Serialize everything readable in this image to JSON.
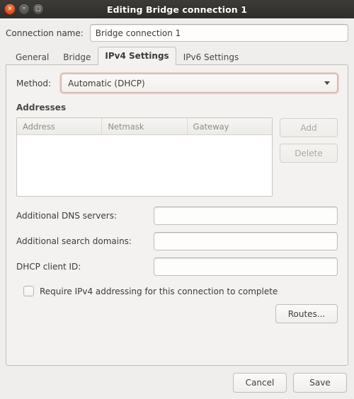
{
  "window": {
    "title": "Editing Bridge connection 1",
    "controls": {
      "close_glyph": "×",
      "minimize_glyph": "–",
      "maximize_glyph": "□"
    },
    "accent_color": "#dd7249",
    "titlebar_color": "#3c3b37"
  },
  "connection": {
    "name_label": "Connection name:",
    "name_value": "Bridge connection 1"
  },
  "tabs": [
    {
      "label": "General",
      "active": false
    },
    {
      "label": "Bridge",
      "active": false
    },
    {
      "label": "IPv4 Settings",
      "active": true
    },
    {
      "label": "IPv6 Settings",
      "active": false
    }
  ],
  "ipv4": {
    "method_label": "Method:",
    "method_value": "Automatic (DHCP)",
    "addresses_label": "Addresses",
    "table": {
      "columns": [
        "Address",
        "Netmask",
        "Gateway"
      ],
      "rows": []
    },
    "add_label": "Add",
    "delete_label": "Delete",
    "fields": [
      {
        "label": "Additional DNS servers:",
        "value": ""
      },
      {
        "label": "Additional search domains:",
        "value": ""
      },
      {
        "label": "DHCP client ID:",
        "value": ""
      }
    ],
    "require_ipv4_label": "Require IPv4 addressing for this connection to complete",
    "require_ipv4_checked": false,
    "routes_label": "Routes..."
  },
  "footer": {
    "cancel_label": "Cancel",
    "save_label": "Save"
  }
}
